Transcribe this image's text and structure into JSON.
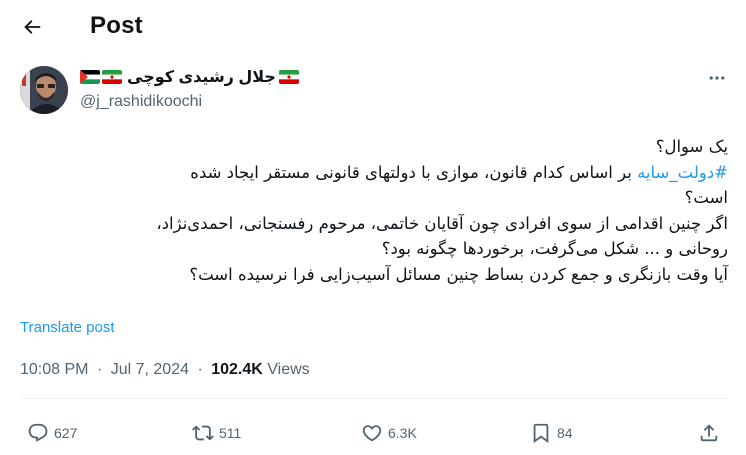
{
  "header": {
    "title": "Post",
    "back_icon": "arrow-left-icon"
  },
  "author": {
    "display_name": "جلال رشیدی کوچی",
    "handle": "@j_rashidikoochi",
    "flags": [
      "iran-flag-icon",
      "iran-flag-icon",
      "palestine-flag-icon"
    ]
  },
  "tweet": {
    "lines": {
      "l1": "یک سوال؟",
      "l2_hashtag": "#دولت_سایه",
      "l2_rest": " بر اساس کدام قانون، موازی با دولتهای قانونی مستقر ایجاد شده",
      "l3": "است؟",
      "l4": "اگر چنین اقدامی از سوی افرادی چون آقایان خاتمی، مرحوم رفسنجانی، احمدی‌نژاد،",
      "l5": "روحانی و ... شکل می‌گرفت، برخوردها چگونه بود؟",
      "l6": "آیا وقت بازنگری و جمع کردن بساط چنین مسائل آسیب‌زایی فرا نرسیده است؟"
    },
    "translate_label": "Translate post"
  },
  "meta": {
    "time": "10:08 PM",
    "date": "Jul 7, 2024",
    "separator": "·",
    "views_count": "102.4K",
    "views_label": "Views"
  },
  "actions": {
    "replies": "627",
    "reposts": "511",
    "likes": "6.3K",
    "bookmarks": "84"
  },
  "colors": {
    "link": "#1d9bf0",
    "secondary_text": "#536471",
    "primary_text": "#0f1419",
    "divider": "#eff3f4"
  }
}
